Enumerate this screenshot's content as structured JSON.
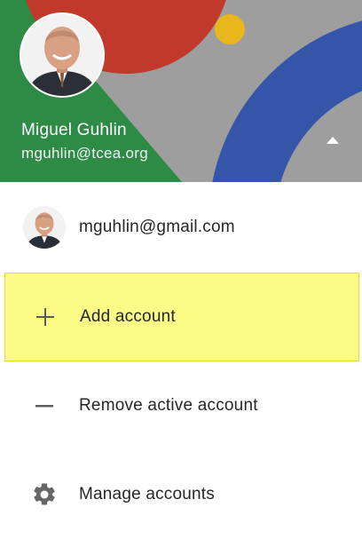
{
  "header": {
    "user_name": "Miguel Guhlin",
    "user_email": "mguhlin@tcea.org",
    "expand_icon": "triangle-up-icon",
    "colors": {
      "background": "#9e9e9e",
      "green": "#2e8b45",
      "red": "#c0392b",
      "yellow": "#e8b71c",
      "blue": "#3556a8"
    }
  },
  "accounts": [
    {
      "email": "mguhlin@gmail.com"
    }
  ],
  "menu": {
    "add_account": {
      "label": "Add account",
      "icon": "plus-icon"
    },
    "remove_account": {
      "label": "Remove active account",
      "icon": "minus-icon"
    },
    "manage_accounts": {
      "label": "Manage accounts",
      "icon": "gear-icon"
    }
  },
  "highlight_color": "#fbfb86"
}
